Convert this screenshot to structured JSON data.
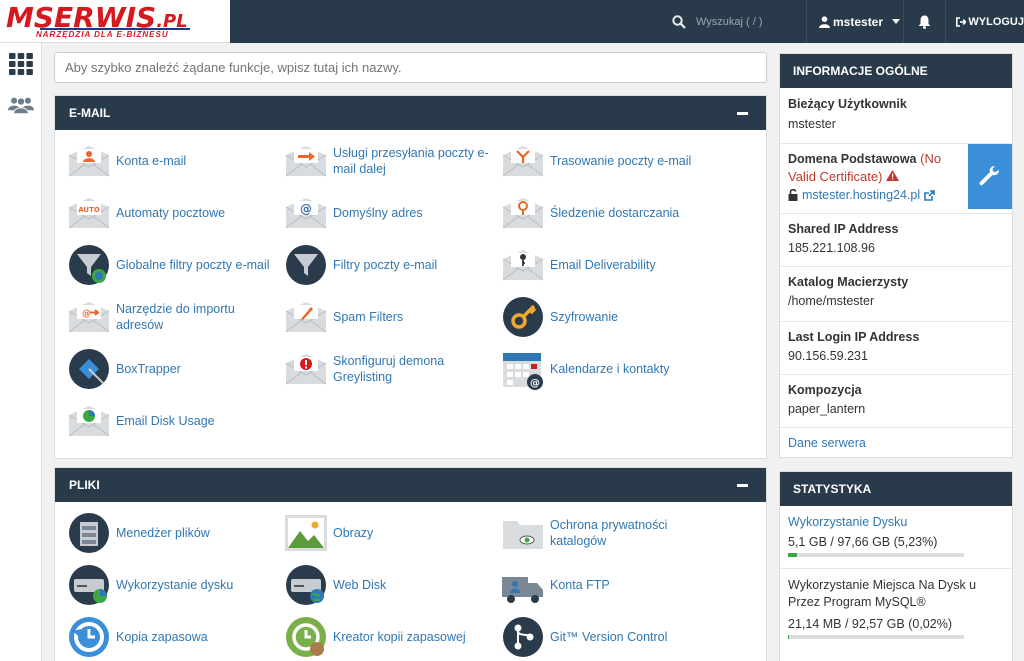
{
  "brand": {
    "logo_main": "MSERWIS",
    "logo_suffix": ".PL",
    "logo_tagline": "NARZĘDZIA DLA E-BIZNESU"
  },
  "topbar": {
    "search_placeholder": "Wyszukaj ( / )",
    "username": "mstester",
    "logout_label": "WYLOGUJ"
  },
  "quick_search": {
    "placeholder": "Aby szybko znaleźć żądane funkcje, wpisz tutaj ich nazwy."
  },
  "email": {
    "title": "E-MAIL",
    "items": [
      {
        "label": "Konta e-mail",
        "icon": "email-accounts-icon"
      },
      {
        "label": "Usługi przesyłania poczty e-mail dalej",
        "icon": "forwarders-icon"
      },
      {
        "label": "Trasowanie poczty e-mail",
        "icon": "email-routing-icon"
      },
      {
        "label": "Automaty pocztowe",
        "icon": "autoresponders-icon"
      },
      {
        "label": "Domyślny adres",
        "icon": "default-address-icon"
      },
      {
        "label": "Śledzenie dostarczania",
        "icon": "track-delivery-icon"
      },
      {
        "label": "Globalne filtry poczty e-mail",
        "icon": "global-filters-icon"
      },
      {
        "label": "Filtry poczty e-mail",
        "icon": "email-filters-icon"
      },
      {
        "label": "Email Deliverability",
        "icon": "deliverability-icon"
      },
      {
        "label": "Narzędzie do importu adresów",
        "icon": "address-importer-icon"
      },
      {
        "label": "Spam Filters",
        "icon": "spam-filters-icon"
      },
      {
        "label": "Szyfrowanie",
        "icon": "encryption-icon"
      },
      {
        "label": "BoxTrapper",
        "icon": "boxtrapper-icon"
      },
      {
        "label": "Skonfiguruj demona Greylisting",
        "icon": "greylisting-icon"
      },
      {
        "label": "Kalendarze i kontakty",
        "icon": "calendars-icon"
      },
      {
        "label": "Email Disk Usage",
        "icon": "email-disk-usage-icon"
      }
    ]
  },
  "files": {
    "title": "PLIKI",
    "items": [
      {
        "label": "Menedżer plików",
        "icon": "file-manager-icon"
      },
      {
        "label": "Obrazy",
        "icon": "images-icon"
      },
      {
        "label": "Ochrona prywatności katalogów",
        "icon": "directory-privacy-icon"
      },
      {
        "label": "Wykorzystanie dysku",
        "icon": "disk-usage-icon"
      },
      {
        "label": "Web Disk",
        "icon": "web-disk-icon"
      },
      {
        "label": "Konta FTP",
        "icon": "ftp-accounts-icon"
      },
      {
        "label": "Kopia zapasowa",
        "icon": "backup-icon"
      },
      {
        "label": "Kreator kopii zapasowej",
        "icon": "backup-wizard-icon"
      },
      {
        "label": "Git™ Version Control",
        "icon": "git-icon"
      }
    ]
  },
  "general_info": {
    "title": "INFORMACJE OGÓLNE",
    "current_user_label": "Bieżący Użytkownik",
    "current_user": "mstester",
    "primary_domain_label": "Domena Podstawowa",
    "cert_warning": "(No Valid Certificate)",
    "domain": "mstester.hosting24.pl",
    "shared_ip_label": "Shared IP Address",
    "shared_ip": "185.221.108.96",
    "home_dir_label": "Katalog Macierzysty",
    "home_dir": "/home/mstester",
    "last_login_label": "Last Login IP Address",
    "last_login_ip": "90.156.59.231",
    "theme_label": "Kompozycja",
    "theme": "paper_lantern",
    "server_info_link": "Dane serwera"
  },
  "stats": {
    "title": "STATYSTYKA",
    "disk_usage_label": "Wykorzystanie Dysku",
    "disk_usage_value": "5,1 GB / 97,66 GB   (5,23%)",
    "disk_usage_fraction": 0.0523,
    "mysql_label": "Wykorzystanie Miejsca Na Dysk u Przez Program MySQL®",
    "mysql_value": "21,14 MB / 92,57 GB   (0,02%)",
    "mysql_fraction": 0.0002
  },
  "colors": {
    "navy": "#293a4a",
    "link": "#2f78b4",
    "accent": "#3b8ed8",
    "brand_red": "#d6181f"
  }
}
